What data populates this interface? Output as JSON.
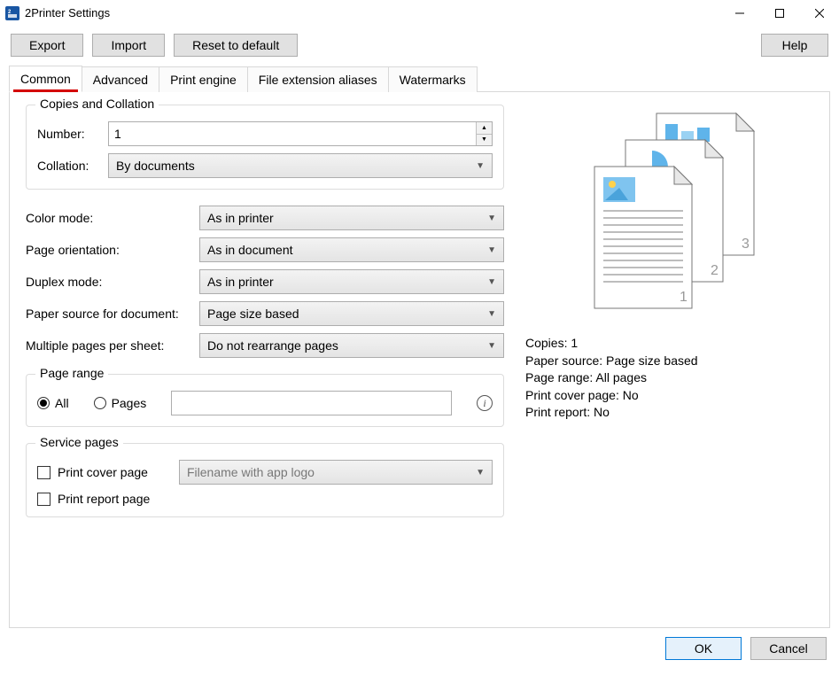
{
  "window": {
    "title": "2Printer Settings"
  },
  "toolbar": {
    "export": "Export",
    "import": "Import",
    "reset": "Reset to default",
    "help": "Help"
  },
  "tabs": [
    {
      "label": "Common",
      "active": true
    },
    {
      "label": "Advanced",
      "active": false
    },
    {
      "label": "Print engine",
      "active": false
    },
    {
      "label": "File extension aliases",
      "active": false
    },
    {
      "label": "Watermarks",
      "active": false
    }
  ],
  "copies_group": {
    "legend": "Copies and Collation",
    "number_label": "Number:",
    "number_value": "1",
    "collation_label": "Collation:",
    "collation_value": "By documents"
  },
  "settings": {
    "color_mode": {
      "label": "Color mode:",
      "value": "As in printer"
    },
    "orientation": {
      "label": "Page orientation:",
      "value": "As in document"
    },
    "duplex": {
      "label": "Duplex mode:",
      "value": "As in printer"
    },
    "paper_source": {
      "label": "Paper source for document:",
      "value": "Page size based"
    },
    "multi_per_sheet": {
      "label": "Multiple pages per sheet:",
      "value": "Do not rearrange pages"
    }
  },
  "page_range": {
    "legend": "Page range",
    "all_label": "All",
    "pages_label": "Pages",
    "pages_value": ""
  },
  "service_pages": {
    "legend": "Service pages",
    "cover_label": "Print cover page",
    "cover_style": "Filename with app logo",
    "report_label": "Print report page"
  },
  "summary": {
    "copies": "Copies: 1",
    "paper_source": "Paper source: Page size based",
    "page_range": "Page range: All pages",
    "cover": "Print cover page: No",
    "report": "Print report: No"
  },
  "footer": {
    "ok": "OK",
    "cancel": "Cancel"
  }
}
